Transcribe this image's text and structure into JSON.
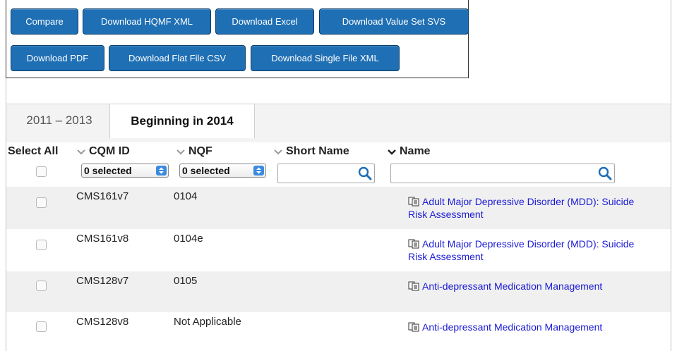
{
  "toolbar": {
    "compare": "Compare",
    "download_hqmf_xml": "Download HQMF XML",
    "download_excel": "Download Excel",
    "download_value_set_svs": "Download Value Set SVS",
    "download_pdf": "Download PDF",
    "download_flat_file_csv": "Download Flat File CSV",
    "download_single_file_xml": "Download Single File XML"
  },
  "tabs": [
    {
      "label": "2011 – 2013",
      "active": false
    },
    {
      "label": "Beginning in 2014",
      "active": true
    }
  ],
  "columns": {
    "select_all": "Select All",
    "cqm_id": "CQM ID",
    "nqf": "NQF",
    "short_name": "Short Name",
    "name": "Name"
  },
  "filters": {
    "cqm_id_selected": "0 selected",
    "nqf_selected": "0 selected",
    "short_name_search": "",
    "name_search": ""
  },
  "rows": [
    {
      "cqm_id": "CMS161v7",
      "nqf": "0104",
      "short_name": "",
      "name_line1": "Adult Major Depressive Disorder (MDD): Suicide",
      "name_line2": "Risk Assessment"
    },
    {
      "cqm_id": "CMS161v8",
      "nqf": "0104e",
      "short_name": "",
      "name_line1": "Adult Major Depressive Disorder (MDD): Suicide",
      "name_line2": "Risk Assessment"
    },
    {
      "cqm_id": "CMS128v7",
      "nqf": "0105",
      "short_name": "",
      "name_line1": "Anti-depressant Medication Management",
      "name_line2": ""
    },
    {
      "cqm_id": "CMS128v8",
      "nqf": "Not Applicable",
      "short_name": "",
      "name_line1": "Anti-depressant Medication Management",
      "name_line2": ""
    }
  ],
  "colors": {
    "button_bg": "#1f6fb4",
    "link": "#1a1ad6",
    "row_shade": "#f0f0f0"
  },
  "icons": {
    "sort": "chevron-down-icon",
    "search": "search-icon",
    "measure_doc": "document-copy-icon"
  }
}
